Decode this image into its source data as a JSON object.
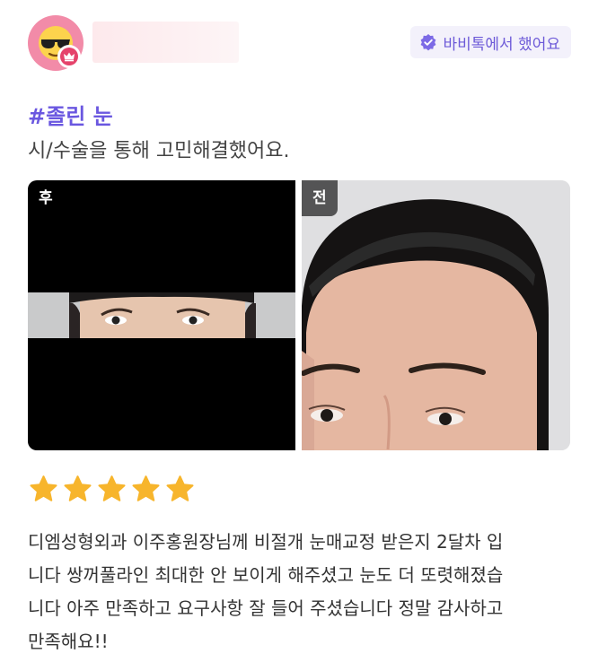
{
  "user": {
    "avatar_icon": "sunglasses-emoji-icon",
    "badge_icon": "crown-icon"
  },
  "verified_badge": {
    "icon": "verified-check-icon",
    "label": "바비톡에서 했어요",
    "color": "#6d5ad8"
  },
  "review": {
    "hashtag": "#졸린 눈",
    "subtitle": "시/수술을 통해 고민해결했어요.",
    "photos": [
      {
        "label": "후"
      },
      {
        "label": "전"
      }
    ],
    "rating": 5,
    "star_color": "#f7b52c",
    "text": "디엠성형외과 이주홍원장님께 비절개 눈매교정 받은지 2달차 입\n니다 쌍꺼풀라인 최대한 안 보이게 해주셨고 눈도 더 또렷해졌습\n니다 아주 만족하고 요구사항 잘 들어 주셨습니다 정말 감사하고\n만족해요!!"
  }
}
